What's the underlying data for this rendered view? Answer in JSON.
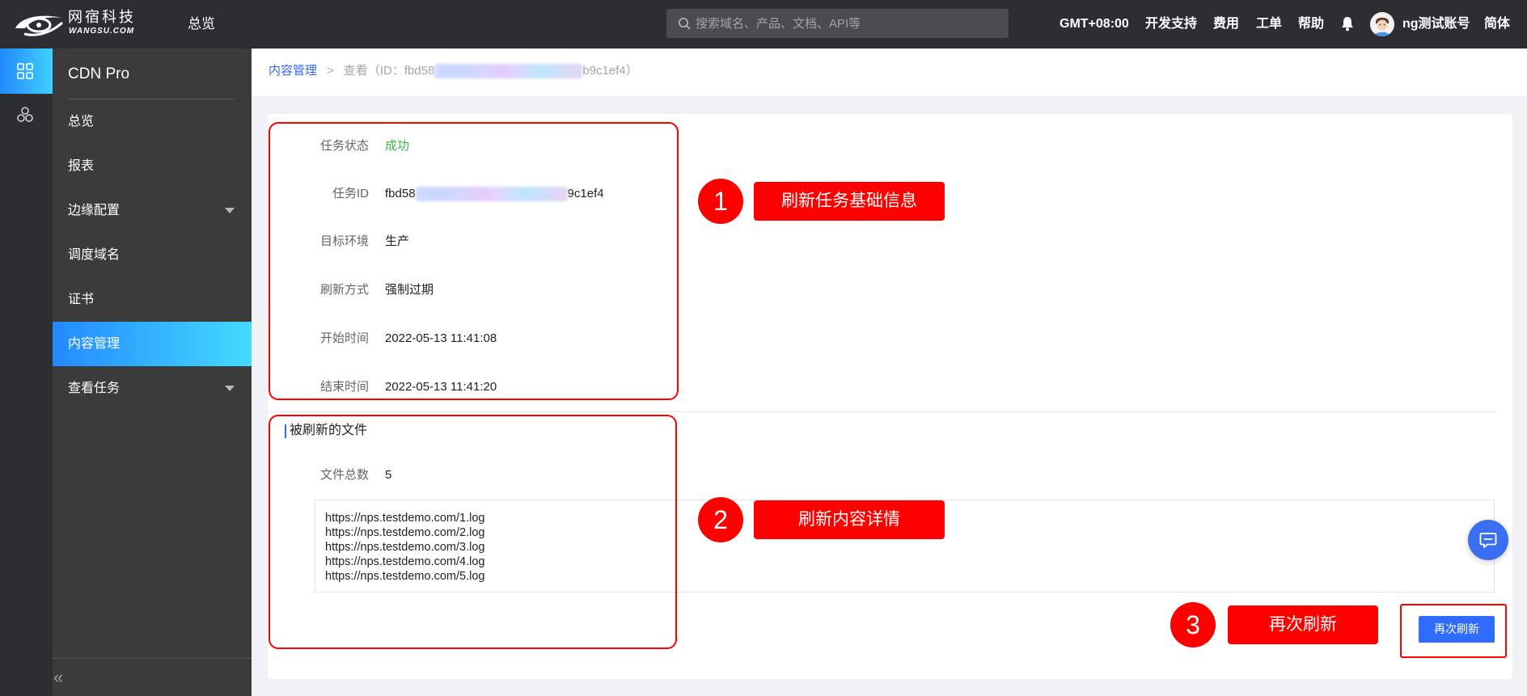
{
  "topbar": {
    "logo_cn": "网宿科技",
    "logo_en": "WANGSU.COM",
    "nav_overview": "总览",
    "search_placeholder": "搜索域名、产品、文档、API等",
    "timezone": "GMT+08:00",
    "dev_support": "开发支持",
    "billing": "费用",
    "ticket": "工单",
    "help": "帮助",
    "account": "ng测试账号",
    "language": "简体"
  },
  "sidebar": {
    "title": "CDN Pro",
    "items": [
      {
        "label": "总览"
      },
      {
        "label": "报表"
      },
      {
        "label": "边缘配置",
        "expandable": true
      },
      {
        "label": "调度域名"
      },
      {
        "label": "证书"
      },
      {
        "label": "内容管理",
        "active": true
      },
      {
        "label": "查看任务",
        "expandable": true
      }
    ],
    "collapse_glyph": "«"
  },
  "breadcrumb": {
    "parent": "内容管理",
    "separator": ">",
    "current_prefix": "查看（ID：fbd58",
    "current_suffix": "b9c1ef4）"
  },
  "task_info": {
    "fields": [
      {
        "label": "任务状态",
        "value": "成功"
      },
      {
        "label": "任务ID",
        "value_prefix": "fbd58",
        "value_suffix": "9c1ef4"
      },
      {
        "label": "目标环境",
        "value": "生产"
      },
      {
        "label": "刷新方式",
        "value": "强制过期"
      },
      {
        "label": "开始时间",
        "value": "2022-05-13 11:41:08"
      },
      {
        "label": "结束时间",
        "value": "2022-05-13 11:41:20"
      }
    ]
  },
  "files": {
    "section_title": "被刷新的文件",
    "count_label": "文件总数",
    "count": "5",
    "urls": [
      "https://nps.testdemo.com/1.log",
      "https://nps.testdemo.com/2.log",
      "https://nps.testdemo.com/3.log",
      "https://nps.testdemo.com/4.log",
      "https://nps.testdemo.com/5.log"
    ]
  },
  "actions": {
    "refresh_again": "再次刷新"
  },
  "annotations": [
    {
      "number": "1",
      "label": "刷新任务基础信息"
    },
    {
      "number": "2",
      "label": "刷新内容详情"
    },
    {
      "number": "3",
      "label": "再次刷新"
    }
  ],
  "icons": {
    "logo": "wangsu-logo-icon",
    "search": "search-icon",
    "notifications": "bell-icon",
    "user": "avatar-icon",
    "rail_dashboard": "grid-icon",
    "rail_products": "cluster-icon",
    "expand": "caret-down-icon",
    "collapse": "double-chevron-left-icon",
    "support_chat": "chat-bubble-icon"
  },
  "colors": {
    "topbar_bg": "#2c2e32",
    "sidebar_bg": "#3b3b3b",
    "active_gradient_start": "#2389ff",
    "active_gradient_end": "#44dcff",
    "link": "#2f6bff",
    "success": "#3cb44b",
    "primary_button": "#2f6bff",
    "annotation": "#ff0000"
  }
}
